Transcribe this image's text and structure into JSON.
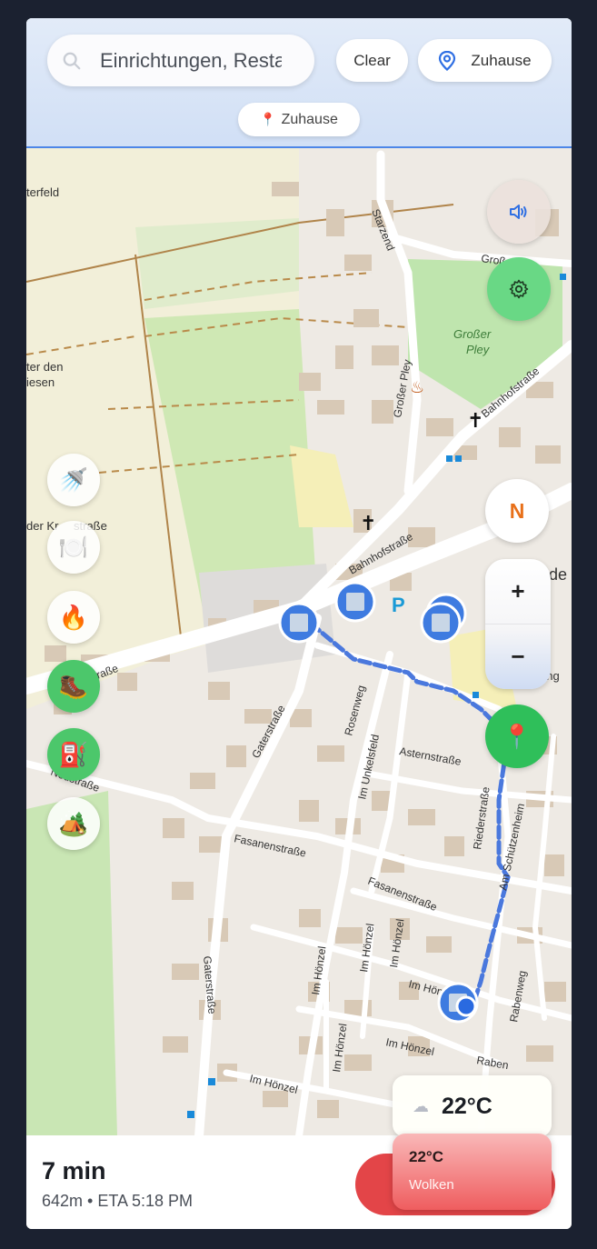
{
  "search": {
    "placeholder": "Einrichtungen, Restaurants",
    "value": "Einrichtungen, Resta",
    "icon": "search-icon"
  },
  "header": {
    "clear_label": "Clear",
    "home_label": "Zuhause",
    "home_icon": "location-pin-outline-icon"
  },
  "destination_chip": {
    "label": "Zuhause",
    "icon": "red-pushpin-icon"
  },
  "categories": [
    {
      "name": "shower",
      "icon": "🚿",
      "active": false
    },
    {
      "name": "restaurant",
      "icon": "🍽️",
      "active": false
    },
    {
      "name": "fire",
      "icon": "🔥",
      "active": false
    },
    {
      "name": "hiking",
      "icon": "🥾",
      "active": true
    },
    {
      "name": "fuel",
      "icon": "⛽",
      "active": true
    },
    {
      "name": "camping",
      "icon": "🏕️",
      "active": false
    }
  ],
  "controls": {
    "compass_label": "N",
    "zoom_in": "+",
    "zoom_out": "−",
    "sound_icon": "speaker-icon",
    "settings_icon": "gear-icon",
    "destination_icon": "📍"
  },
  "map_labels": {
    "streets": [
      "Starzend",
      "Großer",
      "Bahnhofstraße",
      "Bahnhofstraße",
      "Großer Pley",
      "Gaterstraße",
      "Rosenweg",
      "Im Unkelsfeld",
      "Asternstraße",
      "Riederstraße",
      "Am Schützenheim",
      "Fasanenstraße",
      "Fasanenstraße",
      "Neustraße",
      "straße",
      "Im Hönzel",
      "Im Hönzel",
      "Im Hönzel",
      "Im Hönzel",
      "Im Hönzel",
      "Im Hönzel",
      "Im Hönzel",
      "Gaterstraße",
      "Rabenweg",
      "Raben"
    ],
    "areas": [
      "terfeld",
      "ter den",
      "iesen",
      "Großer",
      "Pley",
      "der Kr",
      "straße",
      "de",
      "ung"
    ],
    "parking": "P"
  },
  "route": {
    "time": "7 min",
    "details": "642m • ETA 5:18 PM"
  },
  "weather": {
    "temp_main": "22°C",
    "temp_secondary": "22°C",
    "condition": "Wolken",
    "icon": "cloud-icon"
  },
  "colors": {
    "route": "#4a78dd",
    "accent_green": "#2fbf5a",
    "go_red": "#e34548",
    "compass": "#e8701a"
  }
}
